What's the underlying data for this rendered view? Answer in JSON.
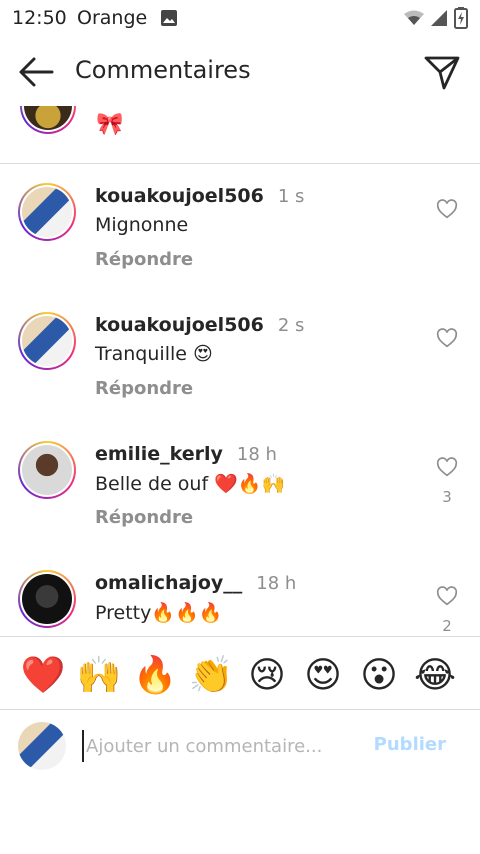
{
  "status_bar": {
    "time": "12:50",
    "carrier": "Orange"
  },
  "header": {
    "title": "Commentaires",
    "back_icon": "arrow-left-icon",
    "send_icon": "paper-plane-icon"
  },
  "previous_comment": {
    "text": "🎀"
  },
  "comments": [
    {
      "username": "kouakoujoel506",
      "time": "1 s",
      "text": "Mignonne",
      "reply_label": "Répondre",
      "likes": ""
    },
    {
      "username": "kouakoujoel506",
      "time": "2 s",
      "text": "Tranquille 😍",
      "reply_label": "Répondre",
      "likes": ""
    },
    {
      "username": "emilie_kerly",
      "time": "18 h",
      "text": "Belle de ouf ❤️🔥🙌",
      "reply_label": "Répondre",
      "likes": "3"
    },
    {
      "username": "omalichajoy__",
      "time": "18 h",
      "text": "Pretty🔥🔥🔥",
      "reply_label": "",
      "likes": "2"
    }
  ],
  "emoji_bar": [
    "❤️",
    "🙌",
    "🔥",
    "👏",
    "😢",
    "😍",
    "😮",
    "😂"
  ],
  "compose": {
    "placeholder": "Ajouter un commentaire...",
    "publish_label": "Publier"
  },
  "colors": {
    "text": "#262626",
    "secondary": "#8e8e8e",
    "publish_disabled": "#b3dbff",
    "divider": "#dcdcdc"
  }
}
